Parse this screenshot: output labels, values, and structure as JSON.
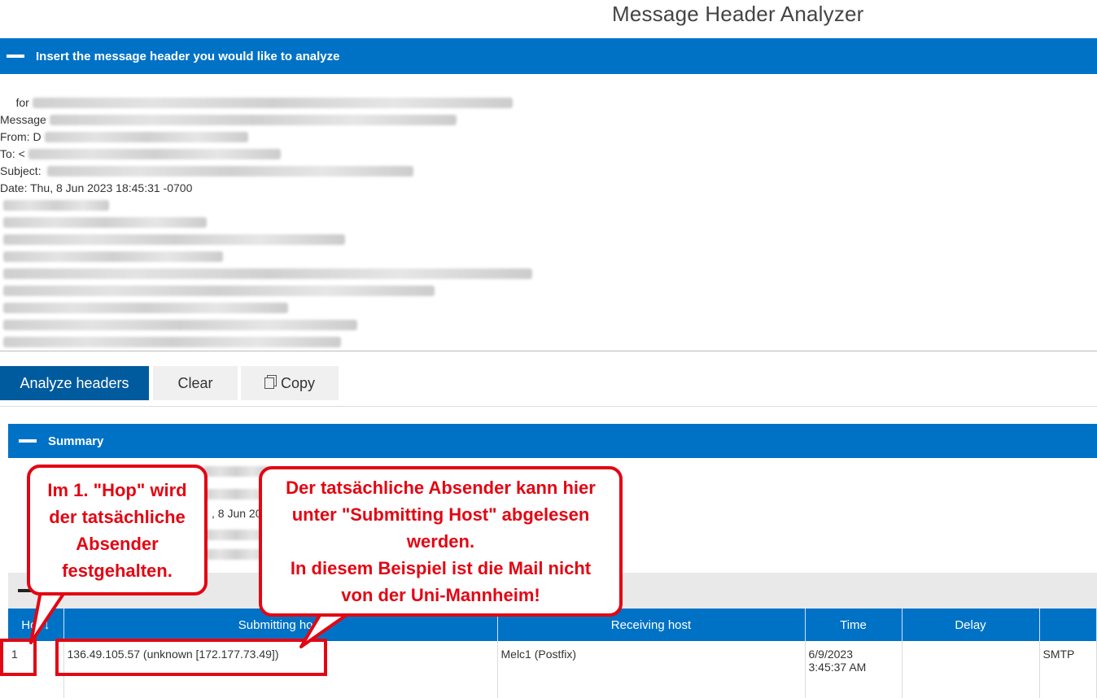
{
  "app": {
    "title": "Message Header Analyzer"
  },
  "insert_section": {
    "title": "Insert the message header you would like to analyze",
    "lines": [
      {
        "label": "",
        "blur_width": 0
      },
      {
        "label": "     for",
        "blur_width": 590
      },
      {
        "label": "Message",
        "blur_width": 500
      },
      {
        "label": "From: D",
        "blur_width": 250
      },
      {
        "label": "To: <",
        "blur_width": 310
      },
      {
        "label": "Subject: ",
        "blur_width": 450
      },
      {
        "label": "Date: Thu, 8 Jun 2023 18:45:31 -0700",
        "blur_width": 0
      },
      {
        "label": "",
        "blur_width": 130
      },
      {
        "label": "",
        "blur_width": 250
      },
      {
        "label": "",
        "blur_width": 420
      },
      {
        "label": "",
        "blur_width": 270
      },
      {
        "label": "",
        "blur_width": 650
      },
      {
        "label": "",
        "blur_width": 530
      },
      {
        "label": "",
        "blur_width": 350
      },
      {
        "label": "",
        "blur_width": 435
      },
      {
        "label": "",
        "blur_width": 415
      }
    ]
  },
  "buttons": {
    "analyze": "Analyze headers",
    "clear": "Clear",
    "copy": "Copy"
  },
  "summary_section": {
    "title": "Summary",
    "date_fragment": ", 8 Jun 20"
  },
  "hops_table": {
    "columns": [
      "Hop↓",
      "Submitting host",
      "Receiving host",
      "Time",
      "Delay",
      ""
    ],
    "rows": [
      {
        "hop": "1",
        "submitting_host": "136.49.105.57 (unknown [172.177.73.49])",
        "receiving_host": "Melc1 (Postfix)",
        "time_date": "6/9/2023",
        "time_clock": "3:45:37 AM",
        "delay": "",
        "protocol": "SMTP"
      }
    ]
  },
  "annotations": {
    "hop_callout": [
      "Im 1. \"Hop\" wird",
      "der tatsächliche",
      "Absender",
      "festgehalten."
    ],
    "submitting_callout": [
      "Der tatsächliche Absender kann hier",
      "unter \"Submitting Host\" abgelesen",
      "werden.",
      "In diesem Beispiel ist die Mail nicht",
      "von der Uni-Mannheim!"
    ],
    "color": "#e30613"
  },
  "colors": {
    "accent": "#0072c6",
    "primary_button": "#005a9e",
    "highlight": "#e30613"
  }
}
